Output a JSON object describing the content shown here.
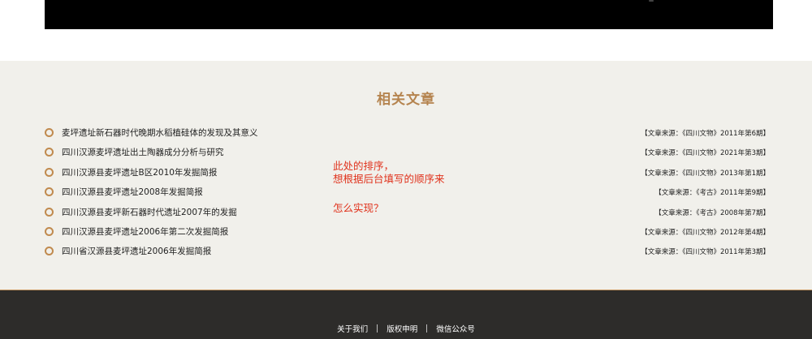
{
  "related": {
    "title": "相关文章",
    "articles": [
      {
        "title": "麦坪遗址新石器时代晚期水稻植硅体的发现及其意义",
        "source": "【文章来源：《四川文物》2011年第6期】"
      },
      {
        "title": "四川汉源麦坪遗址出土陶器成分分析与研究",
        "source": "【文章来源：《四川文物》2021年第3期】"
      },
      {
        "title": "四川汉源县麦坪遗址B区2010年发掘简报",
        "source": "【文章来源：《四川文物》2013年第1期】"
      },
      {
        "title": "四川汉源县麦坪遗址2008年发掘简报",
        "source": "【文章来源：《考古》2011年第9期】"
      },
      {
        "title": "四川汉源县麦坪新石器时代遗址2007年的发掘",
        "source": "【文章来源：《考古》2008年第7期】"
      },
      {
        "title": "四川汉源县麦坪遗址2006年第二次发掘简报",
        "source": "【文章来源：《四川文物》2012年第4期】"
      },
      {
        "title": "四川省汉源县麦坪遗址2006年发掘简报",
        "source": "【文章来源：《四川文物》2011年第3期】"
      }
    ]
  },
  "annotation": {
    "line1": "此处的排序，",
    "line2": "想根据后台填写的顺序来",
    "line3": "怎么实现？"
  },
  "footer": {
    "links": [
      "关于我们",
      "版权申明",
      "微信公众号"
    ]
  },
  "colors": {
    "accent": "#b5844f",
    "annotation": "#e0321c",
    "footer_bg": "#2d2c2a",
    "section_bg": "#f1f0eb"
  }
}
